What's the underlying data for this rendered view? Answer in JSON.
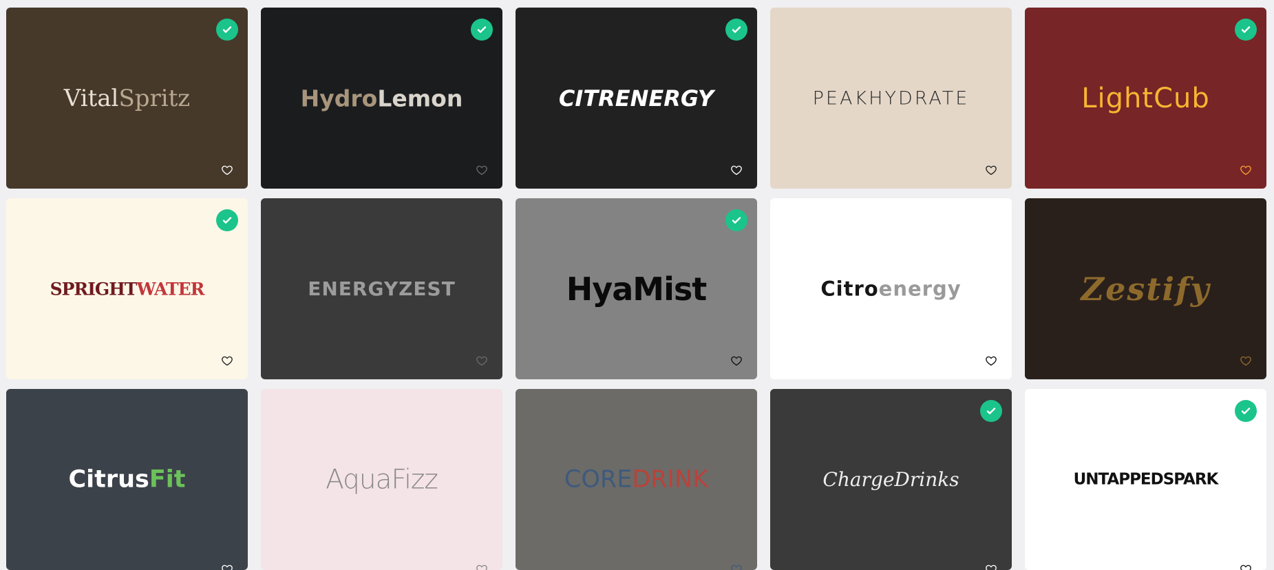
{
  "cards": [
    {
      "id": "vitalspritz",
      "p1": "Vital",
      "p2": "Spritz",
      "bg": "#46392a",
      "c1": "#e8e0d4",
      "c2": "#b9a890",
      "font": "\"DejaVu Serif\", serif",
      "size": 34,
      "weight": "400",
      "style": "normal",
      "spacing": "0px",
      "checked": true,
      "heart": "#ffffff",
      "heart_name": "heart-icon"
    },
    {
      "id": "hydrolemon",
      "p1": "Hydro",
      "p2": "Lemon",
      "bg": "#1b1c1e",
      "c1": "#a8957c",
      "c2": "#d9d4cc",
      "font": "\"DejaVu Sans\", sans-serif",
      "size": 33,
      "weight": "700",
      "style": "normal",
      "spacing": "0px",
      "checked": true,
      "heart": "#6a6a6a",
      "heart_name": "heart-icon"
    },
    {
      "id": "citrenergy",
      "p1": "CITRENERGY",
      "p2": "",
      "bg": "#212121",
      "c1": "#ffffff",
      "c2": "#ffffff",
      "font": "\"DejaVu Sans\", sans-serif",
      "size": 32,
      "weight": "700",
      "style": "italic",
      "spacing": "0px",
      "checked": true,
      "heart": "#ffffff",
      "heart_name": "heart-icon"
    },
    {
      "id": "peakhydrate",
      "p1": "PEAKHYDRATE",
      "p2": "",
      "bg": "#e4d7c8",
      "c1": "#2a2a2a",
      "c2": "#2a2a2a",
      "font": "\"DejaVu Sans\", sans-serif",
      "size": 27,
      "weight": "300",
      "style": "normal",
      "spacing": "3px",
      "checked": false,
      "heart": "#222222",
      "heart_name": "heart-icon"
    },
    {
      "id": "lightcub",
      "p1": "LightCub",
      "p2": "",
      "bg": "#772526",
      "c1": "#f7b532",
      "c2": "#f7b532",
      "font": "\"DejaVu Sans\", sans-serif",
      "size": 40,
      "weight": "400",
      "style": "normal",
      "spacing": "1px",
      "checked": true,
      "heart": "#f7a032",
      "heart_name": "heart-icon"
    },
    {
      "id": "sprightwater",
      "p1": "SPRIGHT",
      "p2": "WATER",
      "bg": "#fdf7e8",
      "c1": "#6f1a1f",
      "c2": "#c2363a",
      "font": "\"DejaVu Serif\", serif",
      "size": 25,
      "weight": "700",
      "style": "normal",
      "spacing": "-1px",
      "checked": true,
      "heart": "#222222",
      "heart_name": "heart-icon"
    },
    {
      "id": "energyzest",
      "p1": "ENERGYZEST",
      "p2": "",
      "bg": "#393a39",
      "c1": "#9c9c9c",
      "c2": "#9c9c9c",
      "font": "\"DejaVu Sans\", sans-serif",
      "size": 28,
      "weight": "700",
      "style": "normal",
      "spacing": "1px",
      "checked": false,
      "heart": "#6a6a6a",
      "heart_name": "heart-icon"
    },
    {
      "id": "hyamist",
      "p1": "HyaMist",
      "p2": "",
      "bg": "#838383",
      "c1": "#0a0a0a",
      "c2": "#0a0a0a",
      "font": "\"DejaVu Sans\", sans-serif",
      "size": 46,
      "weight": "700",
      "style": "normal",
      "spacing": "-1px",
      "checked": true,
      "heart": "#111111",
      "heart_name": "heart-icon"
    },
    {
      "id": "citroenergy",
      "p1": "Citro",
      "p2": "energy",
      "bg": "#ffffff",
      "c1": "#161616",
      "c2": "#9a9a9a",
      "font": "\"DejaVu Sans\", sans-serif",
      "size": 29,
      "weight": "700",
      "style": "normal",
      "spacing": "1px",
      "checked": false,
      "heart": "#111111",
      "heart_name": "heart-icon"
    },
    {
      "id": "zestify",
      "p1": "Zestify",
      "p2": "",
      "bg": "#2a201b",
      "c1": "#8d6a2c",
      "c2": "#8d6a2c",
      "font": "\"DejaVu Serif\", serif",
      "size": 46,
      "weight": "700",
      "style": "italic",
      "spacing": "2px",
      "checked": false,
      "heart": "#8d6a2c",
      "heart_name": "heart-icon"
    },
    {
      "id": "citrusfit",
      "p1": "Citrus",
      "p2": "Fit",
      "bg": "#3c424a",
      "c1": "#ffffff",
      "c2": "#6bc25a",
      "font": "\"DejaVu Sans\", sans-serif",
      "size": 35,
      "weight": "700",
      "style": "normal",
      "spacing": "0px",
      "checked": false,
      "heart": "#ffffff",
      "heart_name": "heart-icon"
    },
    {
      "id": "aquafizz",
      "p1": "Aqua",
      "p2": "Fizz",
      "bg": "#f5e4e7",
      "c1": "#8a8a8a",
      "c2": "#8a8a8a",
      "font": "\"DejaVu Sans\", sans-serif",
      "size": 39,
      "weight": "300",
      "style": "normal",
      "spacing": "-1px",
      "checked": false,
      "heart": "#888888",
      "heart_name": "heart-icon"
    },
    {
      "id": "coredrink",
      "p1": "CORE",
      "p2": "DRINK",
      "bg": "#6c6b68",
      "c1": "#3e5a7c",
      "c2": "#b8433b",
      "font": "\"DejaVu Sans\", sans-serif",
      "size": 35,
      "weight": "400",
      "style": "normal",
      "spacing": "0px",
      "checked": false,
      "heart": "#3e5a7c",
      "heart_name": "heart-icon"
    },
    {
      "id": "chargedrinks",
      "p1": "ChargeDrinks",
      "p2": "",
      "bg": "#3a3a3a",
      "c1": "#eeeeee",
      "c2": "#eeeeee",
      "font": "\"DejaVu Serif\", serif",
      "size": 28,
      "weight": "400",
      "style": "italic",
      "spacing": "0px",
      "checked": true,
      "heart": "#ffffff",
      "heart_name": "heart-icon"
    },
    {
      "id": "untappedspark",
      "p1": "UNTAPPEDSPARK",
      "p2": "",
      "bg": "#ffffff",
      "c1": "#111111",
      "c2": "#111111",
      "font": "\"DejaVu Sans\", sans-serif",
      "size": 23,
      "weight": "700",
      "style": "normal",
      "spacing": "-1px",
      "checked": true,
      "heart": "#111111",
      "heart_name": "heart-icon"
    }
  ]
}
